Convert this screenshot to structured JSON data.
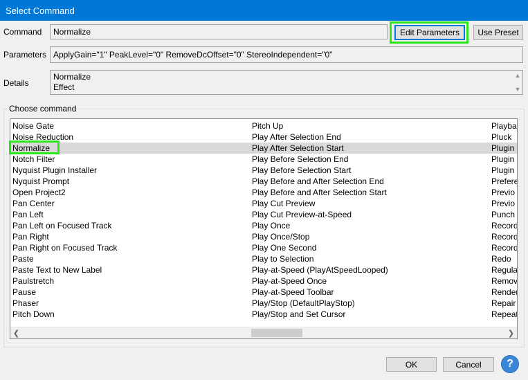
{
  "window": {
    "title": "Select Command"
  },
  "command": {
    "label": "Command",
    "value": "Normalize"
  },
  "buttons": {
    "edit_parameters": "Edit Parameters",
    "use_preset": "Use Preset",
    "ok": "OK",
    "cancel": "Cancel",
    "help": "?"
  },
  "parameters": {
    "label": "Parameters",
    "value": "ApplyGain=\"1\" PeakLevel=\"0\" RemoveDcOffset=\"0\" StereoIndependent=\"0\""
  },
  "details": {
    "label": "Details",
    "line1": "Normalize",
    "line2": "Effect"
  },
  "choose": {
    "title": "Choose command"
  },
  "list": {
    "col1": [
      "Noise Gate",
      "Noise Reduction",
      "Normalize",
      "Notch Filter",
      "Nyquist Plugin Installer",
      "Nyquist Prompt",
      "Open Project2",
      "Pan Center",
      "Pan Left",
      "Pan Left on Focused Track",
      "Pan Right",
      "Pan Right on Focused Track",
      "Paste",
      "Paste Text to New Label",
      "Paulstretch",
      "Pause",
      "Phaser",
      "Pitch Down"
    ],
    "col2": [
      "Pitch Up",
      "Play After Selection End",
      "Play After Selection Start",
      "Play Before Selection End",
      "Play Before Selection Start",
      "Play Before and After Selection End",
      "Play Before and After Selection Start",
      "Play Cut Preview",
      "Play Cut Preview-at-Speed",
      "Play Once",
      "Play Once/Stop",
      "Play One Second",
      "Play to Selection",
      "Play-at-Speed (PlayAtSpeedLooped)",
      "Play-at-Speed Once",
      "Play-at-Speed Toolbar",
      "Play/Stop (DefaultPlayStop)",
      "Play/Stop and Set Cursor"
    ],
    "col3": [
      "Playba",
      "Pluck",
      "Plugin",
      "Plugin",
      "Plugin",
      "Prefere",
      "Previo",
      "Previo",
      "Punch",
      "Record",
      "Record",
      "Record",
      "Redo",
      "Regula",
      "Remov",
      "Render",
      "Repair",
      "Repeat"
    ],
    "selected_index": 2
  }
}
